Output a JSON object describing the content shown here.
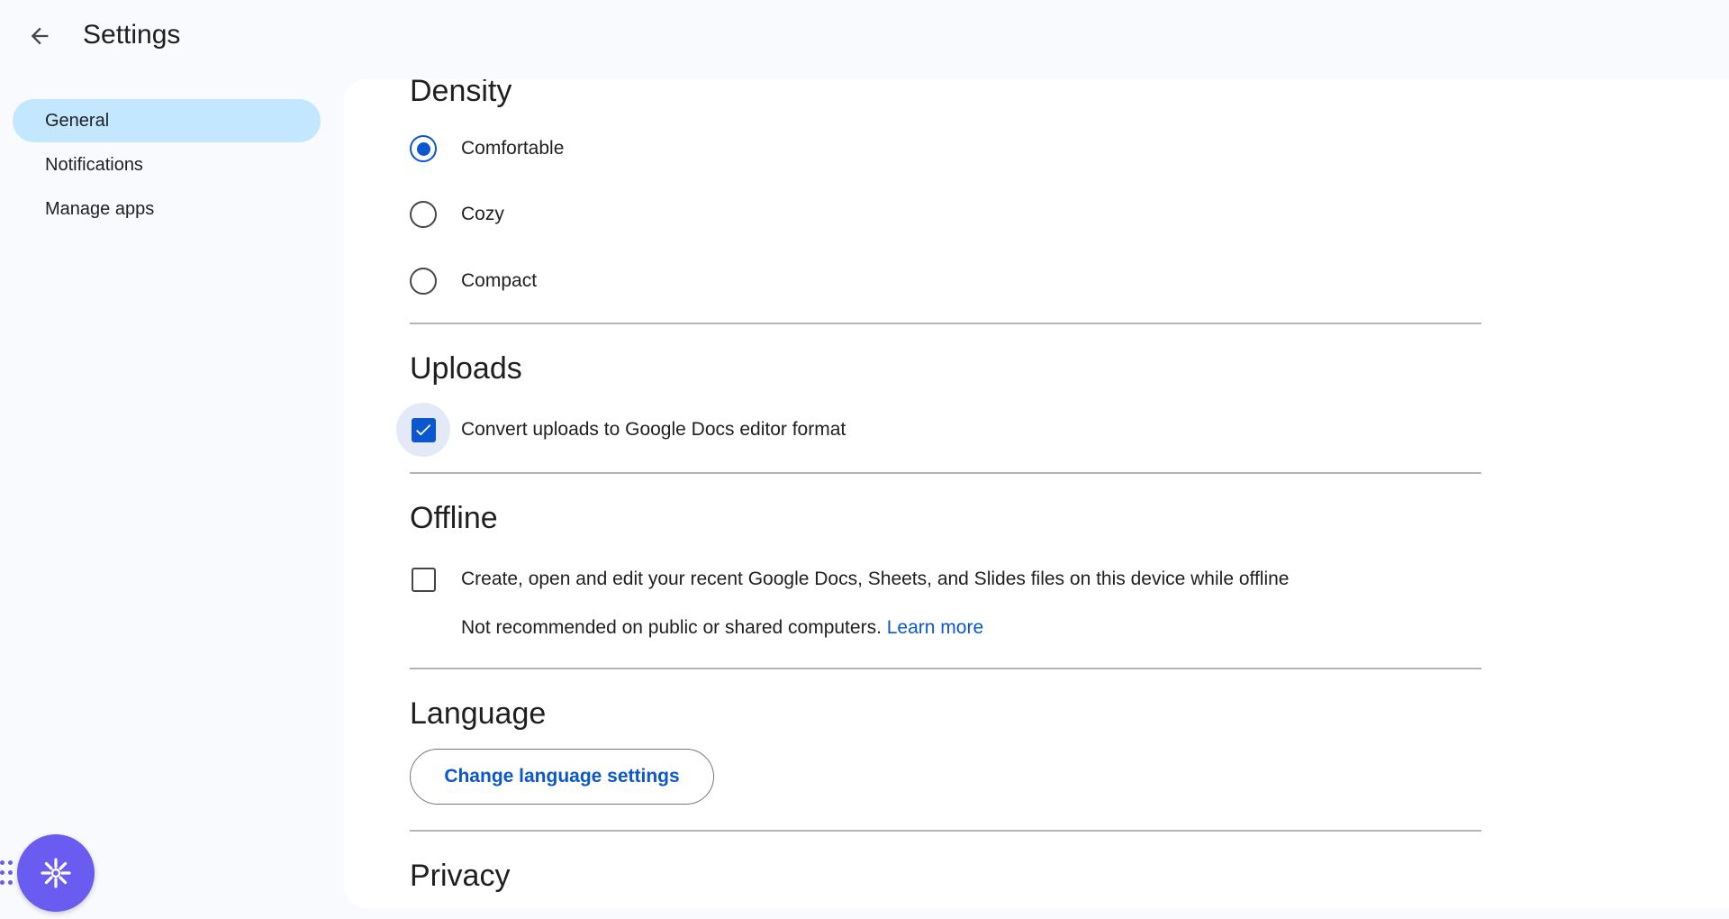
{
  "header": {
    "title": "Settings"
  },
  "sidebar": {
    "items": [
      {
        "label": "General",
        "active": true
      },
      {
        "label": "Notifications",
        "active": false
      },
      {
        "label": "Manage apps",
        "active": false
      }
    ]
  },
  "density": {
    "title": "Density",
    "options": [
      {
        "label": "Comfortable",
        "selected": true
      },
      {
        "label": "Cozy",
        "selected": false
      },
      {
        "label": "Compact",
        "selected": false
      }
    ]
  },
  "uploads": {
    "title": "Uploads",
    "convert_label": "Convert uploads to Google Docs editor format",
    "convert_checked": true
  },
  "offline": {
    "title": "Offline",
    "label": "Create, open and edit your recent Google Docs, Sheets, and Slides files on this device while offline",
    "checked": false,
    "note": "Not recommended on public or shared computers.",
    "learn_more": "Learn more"
  },
  "language": {
    "title": "Language",
    "button_label": "Change language settings"
  },
  "privacy": {
    "title": "Privacy"
  },
  "colors": {
    "accent": "#0b57d0",
    "nav_active": "#c2e7ff",
    "fab": "#6a5cf0"
  }
}
